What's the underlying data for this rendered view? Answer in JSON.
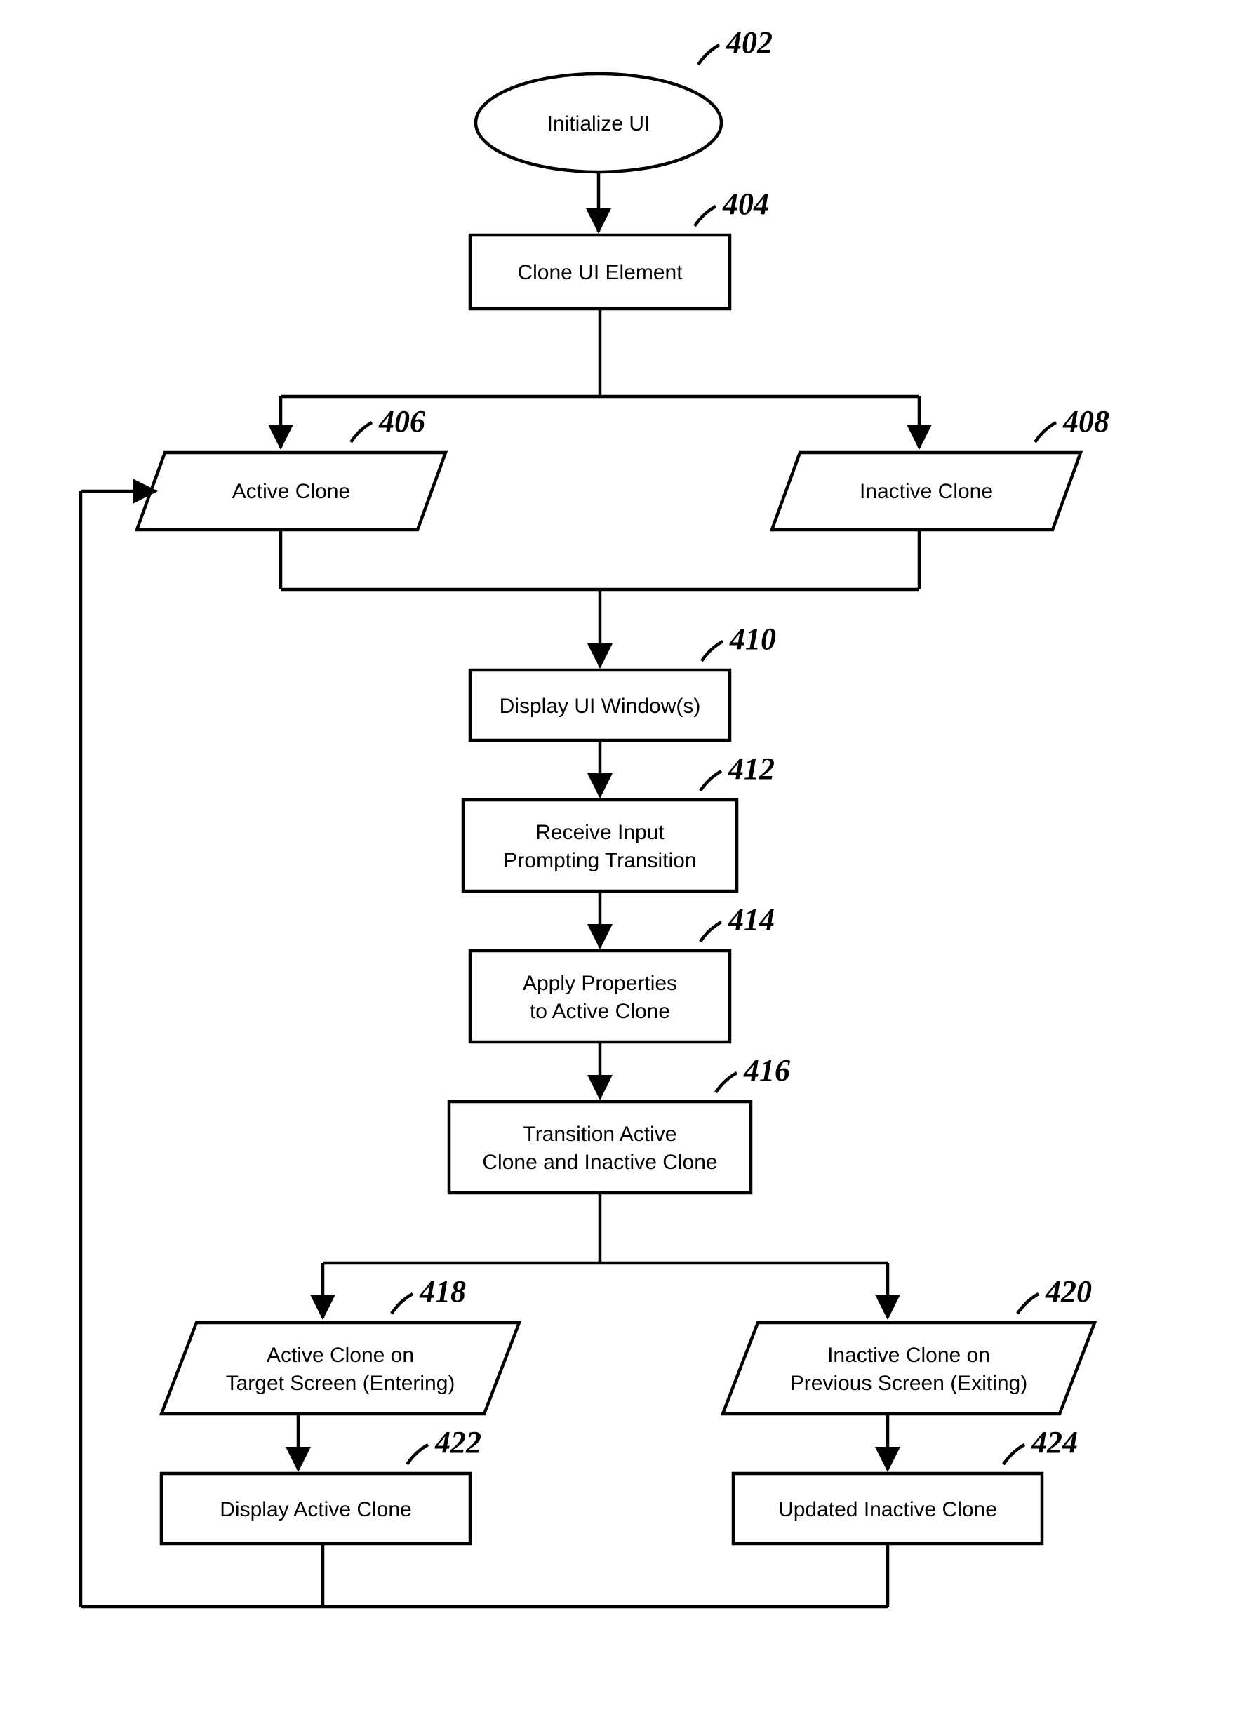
{
  "refs": {
    "n402": "402",
    "n404": "404",
    "n406": "406",
    "n408": "408",
    "n410": "410",
    "n412": "412",
    "n414": "414",
    "n416": "416",
    "n418": "418",
    "n420": "420",
    "n422": "422",
    "n424": "424"
  },
  "nodes": {
    "n402": "Initialize UI",
    "n404": "Clone UI Element",
    "n406": "Active Clone",
    "n408": "Inactive Clone",
    "n410": "Display UI Window(s)",
    "n412_l1": "Receive Input",
    "n412_l2": "Prompting Transition",
    "n414_l1": "Apply Properties",
    "n414_l2": "to Active Clone",
    "n416_l1": "     Transition Active",
    "n416_l2": "Clone and Inactive Clone",
    "n418_l1": "   Active Clone on",
    "n418_l2": "Target Screen (Entering)",
    "n420_l1": "    Inactive Clone on",
    "n420_l2": "Previous Screen (Exiting)",
    "n422": "Display Active Clone",
    "n424": "Updated Inactive Clone"
  }
}
